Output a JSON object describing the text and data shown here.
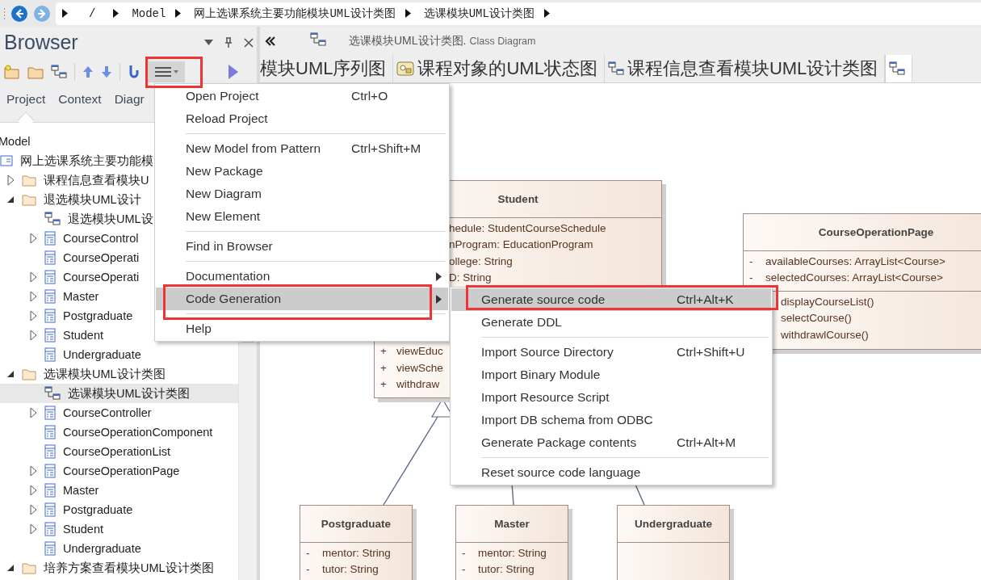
{
  "breadcrumb": {
    "crumbs": [
      "/",
      "Model",
      "网上选课系统主要功能模块UML设计类图",
      "选课模块UML设计类图"
    ]
  },
  "browser": {
    "title": "Browser",
    "tabs": [
      {
        "label": "Project",
        "selected": true
      },
      {
        "label": "Context",
        "selected": false
      },
      {
        "label": "Diagr",
        "selected": false
      }
    ],
    "root_label": "Model",
    "tree": [
      {
        "label": "网上选课系统主要功能模",
        "kind": "package",
        "selected": false,
        "children": [
          {
            "label": "课程信息查看模块U",
            "kind": "folder",
            "expanded": false,
            "selected": false
          },
          {
            "label": "退选模块UML设计",
            "kind": "folder",
            "expanded": true,
            "selected": false,
            "children": [
              {
                "label": "退选模块UML设",
                "kind": "diagram",
                "selected": false
              },
              {
                "label": "CourseControl",
                "kind": "class",
                "expanded": false,
                "selected": false
              },
              {
                "label": "CourseOperati",
                "kind": "class",
                "selected": false
              },
              {
                "label": "CourseOperati",
                "kind": "class",
                "expanded": false,
                "selected": false
              },
              {
                "label": "Master",
                "kind": "class",
                "expanded": false,
                "selected": false
              },
              {
                "label": "Postgraduate",
                "kind": "class",
                "expanded": false,
                "selected": false
              },
              {
                "label": "Student",
                "kind": "class",
                "expanded": false,
                "selected": false
              },
              {
                "label": "Undergraduate",
                "kind": "class",
                "selected": false
              }
            ]
          },
          {
            "label": "选课模块UML设计类图",
            "kind": "folder",
            "expanded": true,
            "selected": false,
            "children": [
              {
                "label": "选课模块UML设计类图",
                "kind": "diagram",
                "selected": true
              },
              {
                "label": "CourseController",
                "kind": "class",
                "expanded": false,
                "selected": false
              },
              {
                "label": "CourseOperationComponent",
                "kind": "class",
                "selected": false
              },
              {
                "label": "CourseOperationList",
                "kind": "class",
                "selected": false
              },
              {
                "label": "CourseOperationPage",
                "kind": "class",
                "expanded": false,
                "selected": false
              },
              {
                "label": "Master",
                "kind": "class",
                "expanded": false,
                "selected": false
              },
              {
                "label": "Postgraduate",
                "kind": "class",
                "expanded": false,
                "selected": false
              },
              {
                "label": "Student",
                "kind": "class",
                "expanded": false,
                "selected": false
              },
              {
                "label": "Undergraduate",
                "kind": "class",
                "selected": false
              }
            ]
          },
          {
            "label": "培养方案查看模块UML设计类图",
            "kind": "folder",
            "expanded": true,
            "selected": false
          }
        ]
      }
    ]
  },
  "diagram": {
    "title": "选课模块UML设计类图.",
    "subtitle": "Class Diagram",
    "tabs": [
      {
        "label": "模块UML序列图",
        "selected": false
      },
      {
        "label": "课程对象的UML状态图",
        "kind": "state",
        "selected": false
      },
      {
        "label": "课程信息查看模块UML设计类图",
        "kind": "class",
        "selected": false
      },
      {
        "kind": "class",
        "selected": true
      }
    ],
    "classes": [
      {
        "name": "Student",
        "attributes": [
          {
            "text": "hedule: StudentCourseSchedule"
          },
          {
            "text": "nProgram: EducationProgram"
          },
          {
            "text": "ollege: String"
          },
          {
            "text": "D: String"
          }
        ],
        "methods": [
          {
            "marker": "+",
            "text": "viewEduc"
          },
          {
            "marker": "+",
            "text": "viewSche"
          },
          {
            "marker": "+",
            "text": "withdraw"
          }
        ]
      },
      {
        "name": "CourseOperationPage",
        "attributes": [
          {
            "marker": "-",
            "text": "availableCourses: ArrayList<Course>"
          },
          {
            "marker": "-",
            "text": "selectedCourses: ArrayList<Course>"
          }
        ],
        "methods": [
          {
            "text": "displayCourseList()"
          },
          {
            "text": "selectCourse()"
          },
          {
            "text": "withdrawlCourse()"
          }
        ]
      },
      {
        "name": "Postgraduate",
        "attributes": [
          {
            "marker": "-",
            "text": "mentor: String"
          },
          {
            "marker": "-",
            "text": "tutor: String"
          }
        ]
      },
      {
        "name": "Master",
        "attributes": [
          {
            "marker": "-",
            "text": "mentor: String"
          },
          {
            "marker": "-",
            "text": "tutor: String"
          }
        ]
      },
      {
        "name": "Undergraduate"
      }
    ]
  },
  "menu": {
    "items": [
      {
        "kind": "item",
        "label": "Open Project",
        "shortcut": "Ctrl+O",
        "selected": false
      },
      {
        "kind": "item",
        "label": "Reload Project",
        "selected": false
      },
      {
        "kind": "separator"
      },
      {
        "kind": "item",
        "label": "New Model from Pattern",
        "shortcut": "Ctrl+Shift+M",
        "selected": false
      },
      {
        "kind": "item",
        "label": "New Package",
        "selected": false
      },
      {
        "kind": "item",
        "label": "New Diagram",
        "selected": false
      },
      {
        "kind": "item",
        "label": "New Element",
        "selected": false
      },
      {
        "kind": "separator"
      },
      {
        "kind": "item",
        "label": "Find in Browser",
        "selected": false
      },
      {
        "kind": "separator"
      },
      {
        "kind": "submenu",
        "label": "Documentation",
        "selected": false
      },
      {
        "kind": "submenu",
        "label": "Code Generation",
        "selected": true,
        "items": [
          {
            "kind": "item",
            "label": "Generate source code",
            "shortcut": "Ctrl+Alt+K",
            "selected": true
          },
          {
            "kind": "item",
            "label": "Generate DDL",
            "selected": false
          },
          {
            "kind": "separator"
          },
          {
            "kind": "item",
            "label": "Import Source Directory",
            "shortcut": "Ctrl+Shift+U",
            "selected": false
          },
          {
            "kind": "item",
            "label": "Import Binary Module",
            "selected": false
          },
          {
            "kind": "item",
            "label": "Import Resource Script",
            "selected": false
          },
          {
            "kind": "item",
            "label": "Import DB schema from ODBC",
            "selected": false
          },
          {
            "kind": "item",
            "label": "Generate Package contents",
            "shortcut": "Ctrl+Alt+M",
            "selected": false
          },
          {
            "kind": "separator"
          },
          {
            "kind": "item",
            "label": "Reset source code language",
            "selected": false
          }
        ]
      },
      {
        "kind": "separator"
      },
      {
        "kind": "item",
        "label": "Help",
        "selected": false
      }
    ]
  }
}
